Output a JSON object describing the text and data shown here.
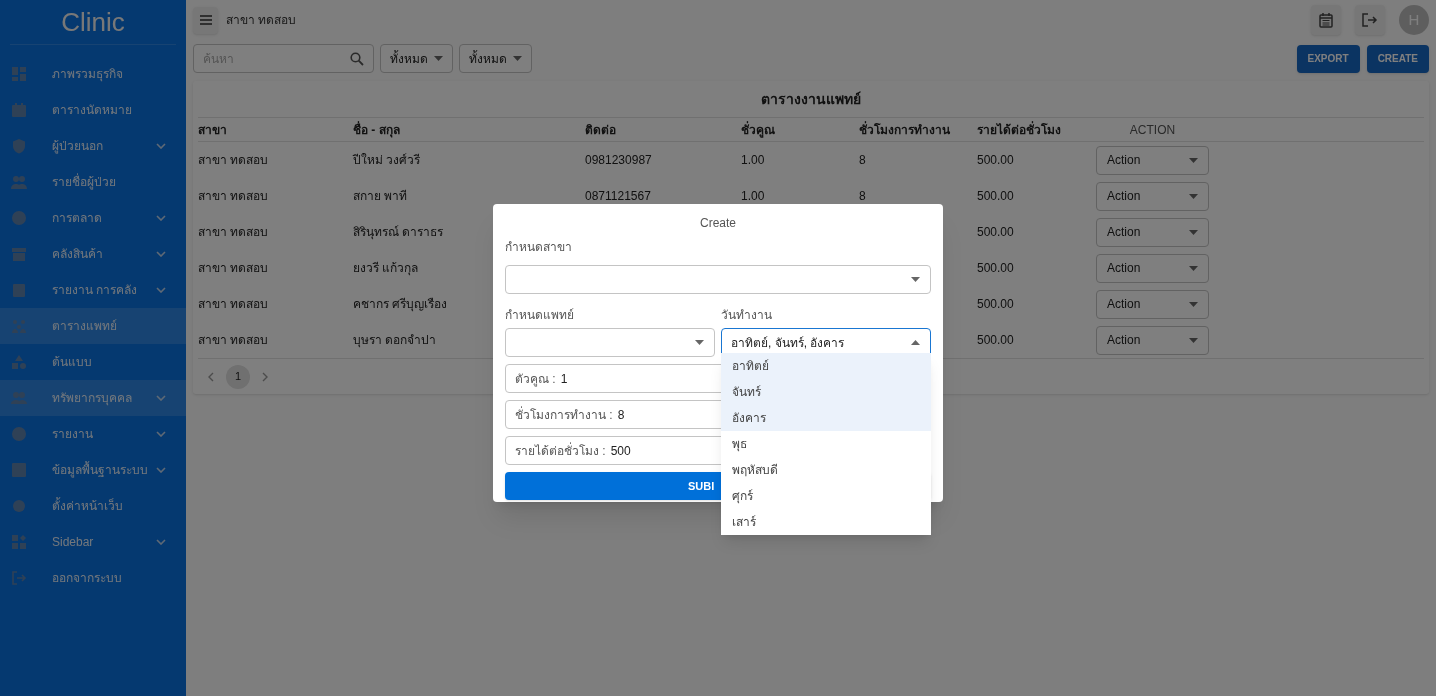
{
  "sidebar": {
    "logo": "Clinic",
    "items": [
      {
        "label": "ภาพรวมธุรกิจ",
        "selected": false,
        "expandable": false
      },
      {
        "label": "ตารางนัดหมาย",
        "selected": false,
        "expandable": false
      },
      {
        "label": "ผู้ป่วยนอก",
        "selected": false,
        "expandable": true
      },
      {
        "label": "รายชื่อผู้ป่วย",
        "selected": false,
        "expandable": false
      },
      {
        "label": "การตลาด",
        "selected": false,
        "expandable": true
      },
      {
        "label": "คลังสินค้า",
        "selected": false,
        "expandable": true
      },
      {
        "label": "รายงาน การคลัง",
        "selected": false,
        "expandable": true
      },
      {
        "label": "ตารางแพทย์",
        "selected": true,
        "expandable": false
      },
      {
        "label": "ต้นแบบ",
        "selected": false,
        "expandable": false
      },
      {
        "label": "ทรัพยากรบุคคล",
        "selected": true,
        "expandable": true
      },
      {
        "label": "รายงาน",
        "selected": false,
        "expandable": true
      },
      {
        "label": "ข้อมูลพื้นฐานระบบ",
        "selected": false,
        "expandable": true
      },
      {
        "label": "ตั้งค่าหน้าเว็บ",
        "selected": false,
        "expandable": false
      },
      {
        "label": "Sidebar",
        "selected": false,
        "expandable": true
      },
      {
        "label": "ออกจากระบบ",
        "selected": false,
        "expandable": false
      }
    ]
  },
  "topbar": {
    "branch": "สาขา ทดสอบ",
    "avatar": "H"
  },
  "toolbar": {
    "search_placeholder": "ค้นหา",
    "filters": [
      "ทั้งหมด",
      "ทั้งหมด"
    ],
    "buttons": [
      "EXPORT",
      "CREATE"
    ]
  },
  "table": {
    "title": "ตารางงานแพทย์",
    "columns": [
      "สาขา",
      "ชื่อ - สกุล",
      "ติดต่อ",
      "ชั่วคูณ",
      "ชั่วโมงการทำงาน",
      "รายได้ต่อชั่วโมง",
      "ACTION"
    ],
    "rows": [
      {
        "branch": "สาขา ทดสอบ",
        "name": "ปีใหม่ วงศ์วรี",
        "contact": "0981230987",
        "multiplier": "1.00",
        "hours": "8",
        "rate": "500.00",
        "action": "Action"
      },
      {
        "branch": "สาขา ทดสอบ",
        "name": "สกาย พาที",
        "contact": "0871121567",
        "multiplier": "1.00",
        "hours": "8",
        "rate": "500.00",
        "action": "Action"
      },
      {
        "branch": "สาขา ทดสอบ",
        "name": "สิรินุทรณ์ ดาราธร",
        "rate": "500.00",
        "action": "Action"
      },
      {
        "branch": "สาขา ทดสอบ",
        "name": "ยงวรี แก้วกุล",
        "rate": "500.00",
        "action": "Action"
      },
      {
        "branch": "สาขา ทดสอบ",
        "name": "คชากร ศรีบุญเรือง",
        "rate": "500.00",
        "action": "Action"
      },
      {
        "branch": "สาขา ทดสอบ",
        "name": "บุษรา ดอกจำปา",
        "rate": "500.00",
        "action": "Action"
      }
    ],
    "pages": [
      {
        "label": "1",
        "selected": true
      }
    ]
  },
  "modal": {
    "title": "Create",
    "branch_label": "กำหนดสาขา",
    "doctor_label": "กำหนดแพทย์",
    "days_label": "วันทำงาน",
    "days_value": "อาทิตย์, จันทร์, อังคาร",
    "fields": [
      {
        "label": "ตัวคูณ :",
        "value": "1"
      },
      {
        "label": "ชั่วโมงการทำงาน :",
        "value": "8"
      },
      {
        "label": "รายได้ต่อชั่วโมง :",
        "value": "500"
      }
    ],
    "submit": "SUBI",
    "day_options": [
      {
        "label": "อาทิตย์",
        "selected": true
      },
      {
        "label": "จันทร์",
        "selected": true
      },
      {
        "label": "อังคาร",
        "selected": true
      },
      {
        "label": "พุธ",
        "selected": false
      },
      {
        "label": "พฤหัสบดี",
        "selected": false
      },
      {
        "label": "ศุกร์",
        "selected": false
      },
      {
        "label": "เสาร์",
        "selected": false
      }
    ]
  }
}
